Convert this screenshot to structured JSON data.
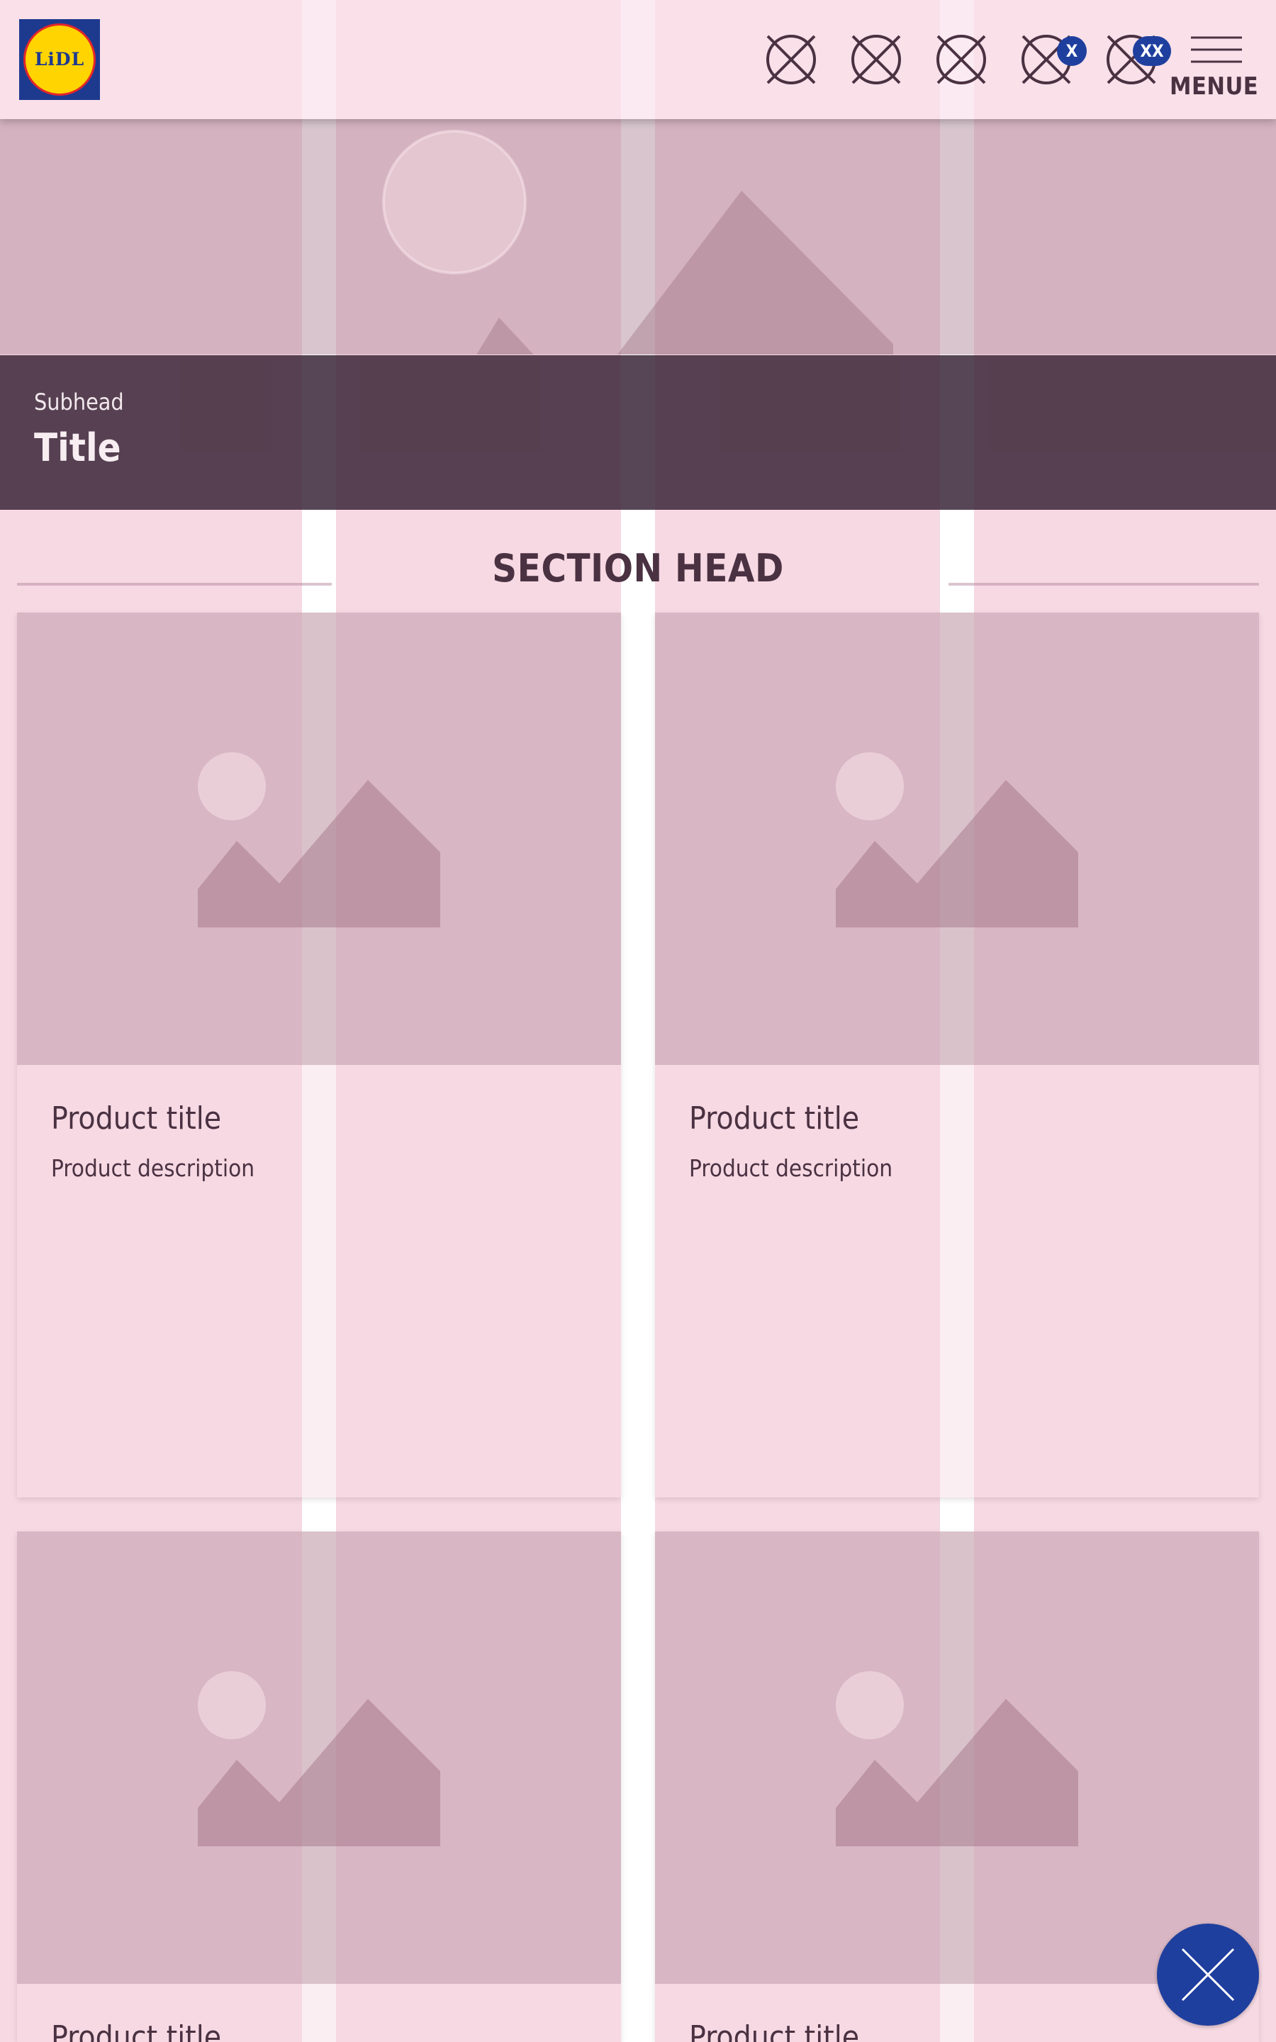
{
  "colors": {
    "grid_column": "#f7d9e3",
    "placeholder_image": "#d6b4c2",
    "hero_band": "#3f2a3b",
    "text": "#4a3242",
    "badge_blue": "#1f3f9e",
    "logo_yellow": "#ffd400",
    "logo_blue": "#1e3a8f",
    "logo_red": "#e2262b"
  },
  "header": {
    "logo_text": "LiDL",
    "icons": [
      {
        "name": "placeholder-icon",
        "badge": ""
      },
      {
        "name": "placeholder-icon",
        "badge": ""
      },
      {
        "name": "placeholder-icon",
        "badge": ""
      },
      {
        "name": "placeholder-icon",
        "badge": "X"
      },
      {
        "name": "placeholder-icon",
        "badge": "XX"
      }
    ],
    "menu_icon": "hamburger-icon",
    "menu_label": "MENUE"
  },
  "hero": {
    "image_icon": "image-placeholder-icon",
    "subhead": "Subhead",
    "title": "Title"
  },
  "section": {
    "head": "SECTION HEAD"
  },
  "products": [
    {
      "title": "Product title",
      "description": "Product description",
      "image_icon": "image-placeholder-icon"
    },
    {
      "title": "Product title",
      "description": "Product description",
      "image_icon": "image-placeholder-icon"
    },
    {
      "title": "Product title",
      "description": "",
      "image_icon": "image-placeholder-icon"
    },
    {
      "title": "Product title",
      "description": "",
      "image_icon": "image-placeholder-icon"
    }
  ],
  "fab": {
    "icon": "close-icon"
  }
}
